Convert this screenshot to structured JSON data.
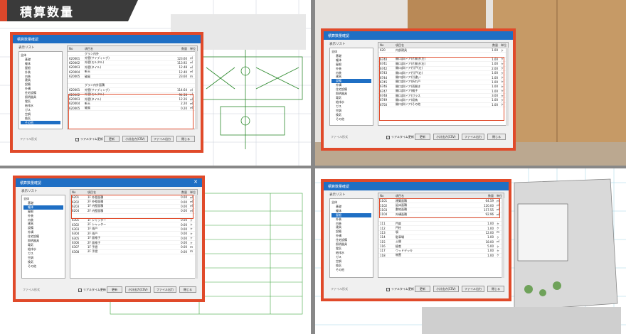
{
  "badge": "積算数量",
  "dialog_title": "積算数量確認",
  "tree_label": "表示リスト",
  "grid_head": {
    "no": "No",
    "name": "項目名",
    "qty": "数量",
    "unit": "単位"
  },
  "buttons": {
    "update": "更新",
    "open": "小計出力(CSV)",
    "file": "ファイル出力",
    "close": "閉じる"
  },
  "realtime": "リアルタイム更新",
  "format": "ファイル形式",
  "tree": [
    "全体",
    "基礎",
    "躯体",
    "屋根",
    "外装",
    "内装",
    "建具",
    "設備",
    "外構",
    "住宅設備",
    "照明器具",
    "電気",
    "給排水",
    "ガス",
    "空調",
    "換気",
    "その他"
  ],
  "q1": {
    "rows": [
      [
        "",
        "グラン内外",
        "",
        ""
      ],
      [
        "620001",
        "外壁(サイディング)",
        "123.60",
        "㎡"
      ],
      [
        "620002",
        "外壁(モルタル)",
        "113.92",
        "㎡"
      ],
      [
        "620003",
        "外壁(タイル)",
        "12.48",
        "㎡"
      ],
      [
        "620004",
        "軒天",
        "12.40",
        "㎡"
      ],
      [
        "620005",
        "破風",
        "23.60",
        "ｍ"
      ],
      [
        "",
        "",
        "",
        " "
      ],
      [
        "",
        "グラン内外面積",
        "",
        ""
      ],
      [
        "620001",
        "外壁(サイディング)",
        "114.64",
        "㎡"
      ],
      [
        "620002",
        "外壁(モルタル)",
        "94.58",
        "㎡"
      ],
      [
        "620003",
        "外壁(タイル)",
        "12.26",
        "㎡"
      ],
      [
        "620004",
        "軒天",
        "2.20",
        "㎡"
      ],
      [
        "620005",
        "破風",
        "0.20",
        "㎡"
      ]
    ]
  },
  "q2": {
    "rows": [
      [
        "620",
        "内部建具",
        "1.00",
        "ヶ"
      ],
      [
        "",
        "",
        "",
        " "
      ],
      [
        "6740",
        "開口部(ドア)片開き(左)",
        "1.00",
        "ヶ"
      ],
      [
        "6741",
        "開口部(ドア)片開き(右)",
        "1.00",
        "ヶ"
      ],
      [
        "6742",
        "開口部(ドア)引戸(左)",
        "2.00",
        "ヶ"
      ],
      [
        "6743",
        "開口部(ドア)引戸(右)",
        "1.00",
        "ヶ"
      ],
      [
        "6744",
        "開口部(ドア)引違い",
        "1.00",
        "ヶ"
      ],
      [
        "6745",
        "開口部(ドア)折れ戸",
        "1.00",
        "ヶ"
      ],
      [
        "6746",
        "開口部(ドア)両開き",
        "1.00",
        "ヶ"
      ],
      [
        "6747",
        "開口部(ドア)親子",
        "1.00",
        "ヶ"
      ],
      [
        "6748",
        "開口部(ドア)ガラス",
        "3.00",
        "ヶ"
      ],
      [
        "6749",
        "開口部(ドア)収納",
        "1.00",
        "ヶ"
      ],
      [
        "6750",
        "開口部(ドア)その他",
        "1.00",
        "ヶ"
      ]
    ]
  },
  "q3": {
    "rows": [
      [
        "6201",
        "1F 外壁面積",
        "0.00",
        "㎡"
      ],
      [
        "6202",
        "2F 外壁面積",
        "0.00",
        "㎡"
      ],
      [
        "6203",
        "1F 内壁面積",
        "0.00",
        "㎡"
      ],
      [
        "6204",
        "2F 内壁面積",
        "0.00",
        "㎡"
      ],
      [
        "",
        "",
        "",
        " "
      ],
      [
        "6301",
        "1F シャッター",
        "0.00",
        "ヶ"
      ],
      [
        "6302",
        "2F シャッター",
        "0.00",
        "ヶ"
      ],
      [
        "6303",
        "1F 雨戸",
        "0.00",
        "ヶ"
      ],
      [
        "6304",
        "2F 雨戸",
        "0.00",
        "ヶ"
      ],
      [
        "6305",
        "1F 面格子",
        "0.00",
        "ヶ"
      ],
      [
        "6306",
        "2F 面格子",
        "0.00",
        "ヶ"
      ],
      [
        "6307",
        "1F 手摺",
        "0.00",
        "ｍ"
      ],
      [
        "6308",
        "2F 手摺",
        "0.00",
        "ｍ"
      ]
    ]
  },
  "q4": {
    "rows": [
      [
        "1101",
        "建築面積",
        "64.59",
        "㎡"
      ],
      [
        "1102",
        "延床面積",
        "120.00",
        "㎡"
      ],
      [
        "1103",
        "敷地面積",
        "157.55",
        "㎡"
      ],
      [
        "1104",
        "外構面積",
        "92.96",
        "㎡"
      ],
      [
        "",
        "",
        "",
        " "
      ],
      [
        "111",
        "門扉",
        "1.00",
        "ヶ"
      ],
      [
        "112",
        "門柱",
        "1.00",
        "ヶ"
      ],
      [
        "113",
        "塀",
        "12.00",
        "ｍ"
      ],
      [
        "114",
        "駐車場",
        "1.00",
        "ヶ"
      ],
      [
        "115",
        "土間",
        "18.00",
        "㎡"
      ],
      [
        "116",
        "植栽",
        "5.00",
        "ヶ"
      ],
      [
        "117",
        "ウッドデッキ",
        "1.00",
        "ヶ"
      ],
      [
        "118",
        "物置",
        "1.00",
        "ヶ"
      ]
    ]
  }
}
